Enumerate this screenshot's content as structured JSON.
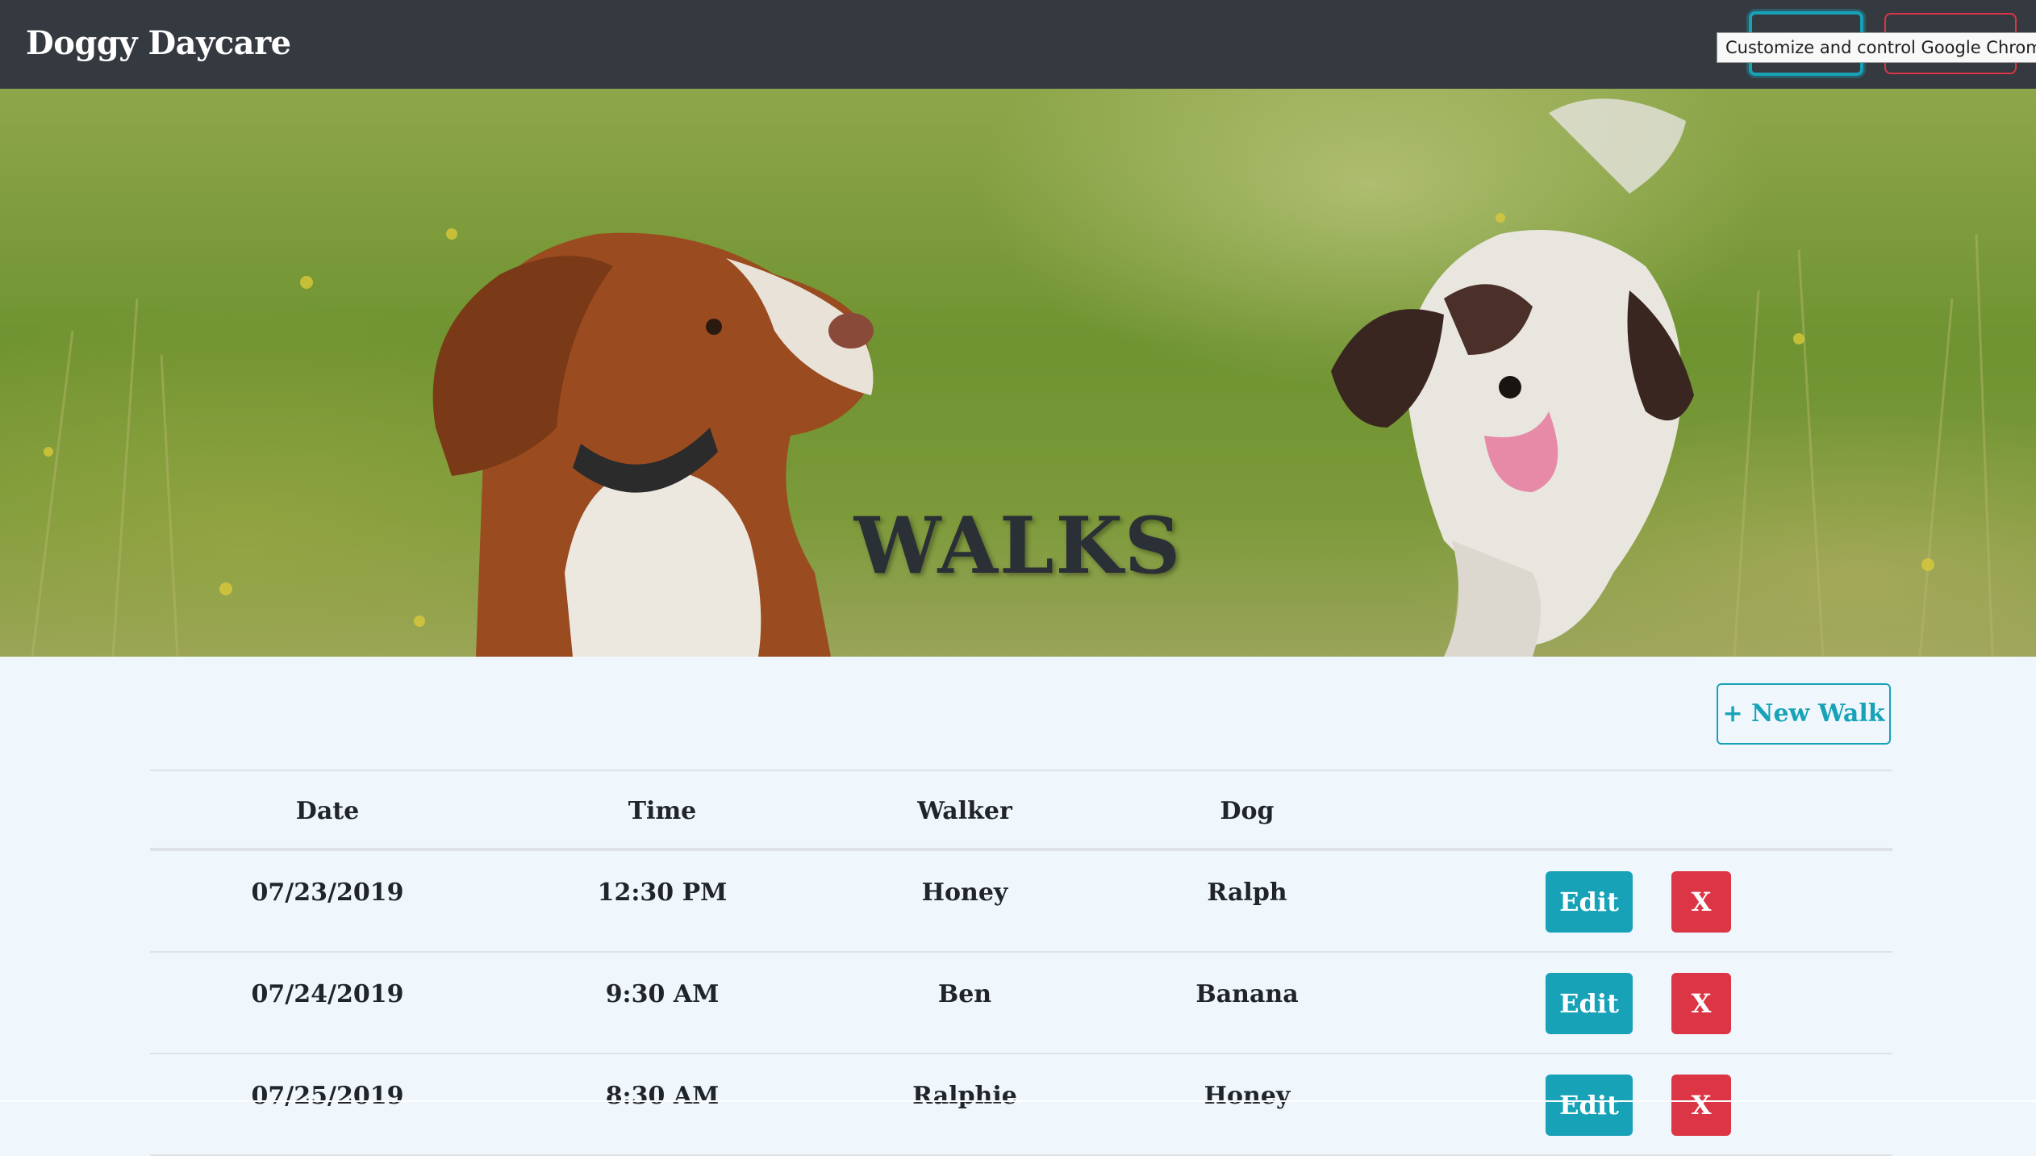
{
  "navbar": {
    "brand": "Doggy Daycare",
    "tooltip": "Customize and control Google Chrome"
  },
  "hero": {
    "title": "WALKS",
    "image": "two-spaniel-dogs-in-grass-field"
  },
  "actions": {
    "new_walk_label": "+ New Walk"
  },
  "table": {
    "headers": {
      "date": "Date",
      "time": "Time",
      "walker": "Walker",
      "dog": "Dog"
    },
    "rows": [
      {
        "date": "07/23/2019",
        "time": "12:30 PM",
        "walker": "Honey",
        "dog": "Ralph",
        "edit": "Edit",
        "delete": "X"
      },
      {
        "date": "07/24/2019",
        "time": "9:30 AM",
        "walker": "Ben",
        "dog": "Banana",
        "edit": "Edit",
        "delete": "X"
      },
      {
        "date": "07/25/2019",
        "time": "8:30 AM",
        "walker": "Ralphie",
        "dog": "Honey",
        "edit": "Edit",
        "delete": "X"
      }
    ]
  },
  "colors": {
    "navbar": "#343a40",
    "page_bg": "#eff7fc",
    "info": "#17a2b8",
    "danger": "#dc3545"
  }
}
